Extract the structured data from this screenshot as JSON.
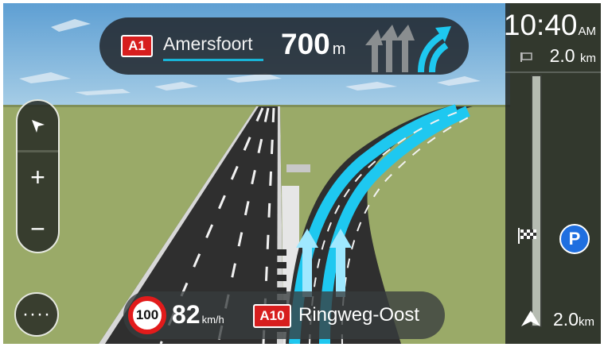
{
  "instruction": {
    "road_number": "A1",
    "destination": "Amersfoort",
    "distance_value": "700",
    "distance_unit": "m",
    "lane_icon": "lane-guidance-keep-right-icon"
  },
  "map_controls": {
    "pointer_icon": "pointer-icon",
    "zoom_in_label": "+",
    "zoom_out_label": "−",
    "menu_label": "····"
  },
  "bottom_bar": {
    "speed_limit": "100",
    "current_speed": "82",
    "speed_unit": "km/h",
    "road_number": "A10",
    "street_name": "Ringweg-Oost"
  },
  "route_bar": {
    "arrival_time": "10:40",
    "arrival_ampm": "AM",
    "remaining_distance_value": "2.0",
    "remaining_distance_unit": "km",
    "parking_label": "P",
    "total_distance_value": "2.0",
    "total_distance_unit": "km"
  },
  "colors": {
    "highlight_lane": "#1ec8f0",
    "road_shield": "#d71e1e",
    "parking": "#1f6fe0",
    "speed_limit_ring": "#e21b1b"
  }
}
